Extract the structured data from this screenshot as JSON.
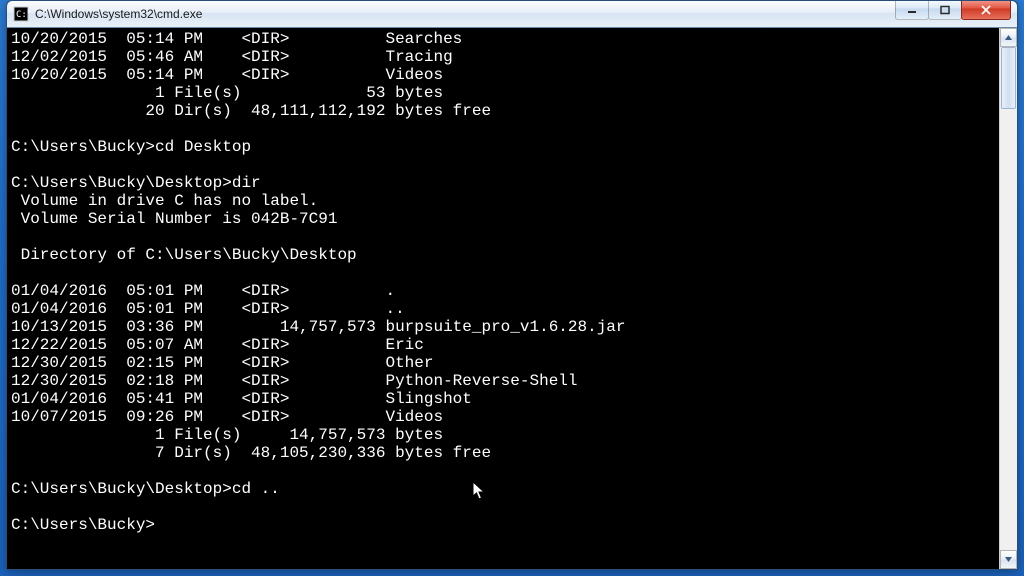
{
  "window": {
    "title": "C:\\Windows\\system32\\cmd.exe"
  },
  "lines": {
    "l0": "10/20/2015  05:14 PM    <DIR>          Searches",
    "l1": "12/02/2015  05:46 AM    <DIR>          Tracing",
    "l2": "10/20/2015  05:14 PM    <DIR>          Videos",
    "l3": "               1 File(s)             53 bytes",
    "l4": "              20 Dir(s)  48,111,112,192 bytes free",
    "l5": "",
    "l6": "C:\\Users\\Bucky>cd Desktop",
    "l7": "",
    "l8": "C:\\Users\\Bucky\\Desktop>dir",
    "l9": " Volume in drive C has no label.",
    "l10": " Volume Serial Number is 042B-7C91",
    "l11": "",
    "l12": " Directory of C:\\Users\\Bucky\\Desktop",
    "l13": "",
    "l14": "01/04/2016  05:01 PM    <DIR>          .",
    "l15": "01/04/2016  05:01 PM    <DIR>          ..",
    "l16": "10/13/2015  03:36 PM        14,757,573 burpsuite_pro_v1.6.28.jar",
    "l17": "12/22/2015  05:07 AM    <DIR>          Eric",
    "l18": "12/30/2015  02:15 PM    <DIR>          Other",
    "l19": "12/30/2015  02:18 PM    <DIR>          Python-Reverse-Shell",
    "l20": "01/04/2016  05:41 PM    <DIR>          Slingshot",
    "l21": "10/07/2015  09:26 PM    <DIR>          Videos",
    "l22": "               1 File(s)     14,757,573 bytes",
    "l23": "               7 Dir(s)  48,105,230,336 bytes free",
    "l24": "",
    "l25": "C:\\Users\\Bucky\\Desktop>cd ..",
    "l26": "",
    "l27": "C:\\Users\\Bucky>"
  }
}
